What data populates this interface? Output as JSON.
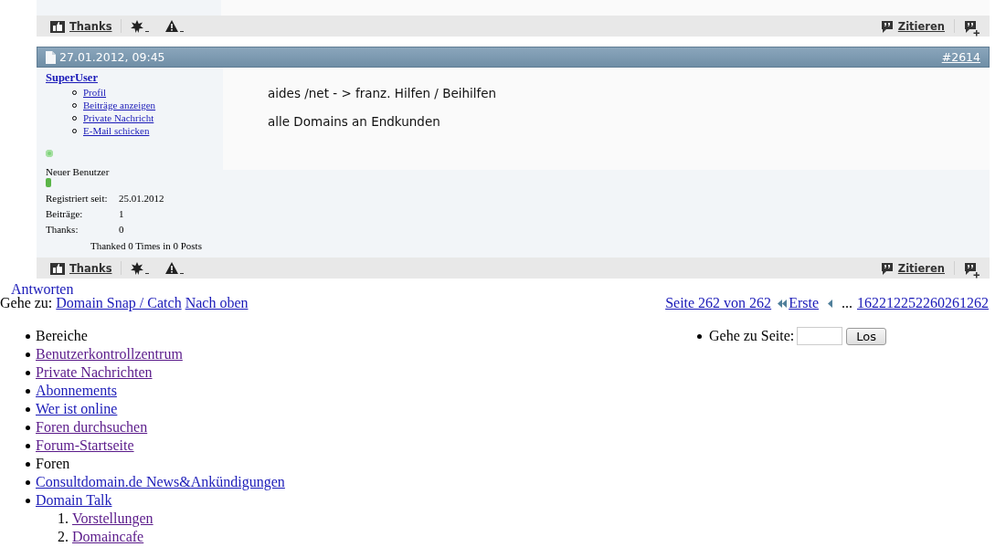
{
  "previous_post": {
    "footer": {
      "thanks": "Thanks",
      "quote": "Zitieren"
    }
  },
  "post": {
    "date": "27.01.2012, 09:45",
    "number": "#2614",
    "username": "SuperUser",
    "user_menu": [
      {
        "text": "Profil"
      },
      {
        "text": "Beiträge anzeigen"
      },
      {
        "text": "Private Nachricht"
      },
      {
        "text": "E-Mail schicken"
      }
    ],
    "online": true,
    "rank": "Neuer Benutzer",
    "stats": [
      {
        "label": "Registriert seit:",
        "value": "25.01.2012"
      },
      {
        "label": "Beiträge:",
        "value": "1"
      },
      {
        "label": "Thanks:",
        "value": "0"
      }
    ],
    "thanked": "Thanked 0 Times in 0 Posts",
    "message": [
      "aides /net - > franz. Hilfen / Beihilfen",
      "alle Domains an Endkunden"
    ],
    "footer": {
      "thanks": "Thanks",
      "quote": "Zitieren"
    }
  },
  "reply_link": "Antworten",
  "goto": {
    "label": "Gehe zu:",
    "forum": "Domain Snap / Catch",
    "top": "Nach oben"
  },
  "pagination": {
    "summary": "Seite 262 von 262",
    "first": "Erste",
    "ellipsis": "...",
    "pages": "162212252260261262"
  },
  "jump": {
    "label": "Gehe zu Seite:",
    "button": "Los"
  },
  "nav": [
    {
      "kind": "heading",
      "text": "Bereiche"
    },
    {
      "kind": "link",
      "text": "Benutzerkontrollzentrum",
      "visited": true
    },
    {
      "kind": "link",
      "text": "Private Nachrichten",
      "visited": true
    },
    {
      "kind": "link",
      "text": "Abonnements",
      "visited": false
    },
    {
      "kind": "link",
      "text": "Wer ist online",
      "visited": false
    },
    {
      "kind": "link",
      "text": "Foren durchsuchen",
      "visited": true
    },
    {
      "kind": "link",
      "text": "Forum-Startseite",
      "visited": true
    },
    {
      "kind": "heading",
      "text": "Foren"
    },
    {
      "kind": "link",
      "text": "Consultdomain.de News&Ankündigungen",
      "visited": false
    },
    {
      "kind": "link",
      "text": "Domain Talk",
      "visited": false,
      "children": [
        {
          "kind": "link",
          "number": "1.",
          "text": "Vorstellungen",
          "visited": true
        },
        {
          "kind": "link",
          "number": "2.",
          "text": "Domaincafe",
          "visited": true
        }
      ]
    }
  ]
}
